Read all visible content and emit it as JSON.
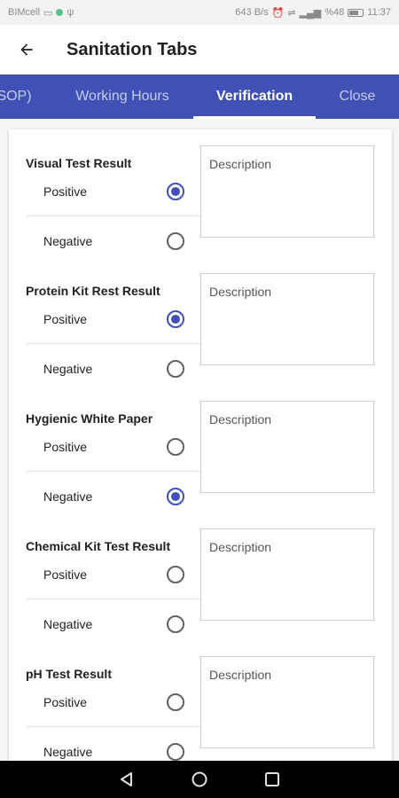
{
  "status_bar": {
    "carrier": "BIMcell",
    "speed": "643 B/s",
    "battery": "%48",
    "time": "11:37"
  },
  "app_bar": {
    "title": "Sanitation Tabs",
    "back_icon": "arrow-back-icon"
  },
  "tabs": [
    {
      "label": "SOP)",
      "active": false
    },
    {
      "label": "Working Hours",
      "active": false
    },
    {
      "label": "Verification",
      "active": true
    },
    {
      "label": "Close",
      "active": false
    }
  ],
  "colors": {
    "primary": "#3f51b5",
    "accent": "#3f51b5"
  },
  "sections": [
    {
      "title": "Visual Test Result",
      "options": [
        "Positive",
        "Negative"
      ],
      "selected": 0,
      "description_placeholder": "Description"
    },
    {
      "title": "Protein Kit Rest Result",
      "options": [
        "Positive",
        "Negative"
      ],
      "selected": 0,
      "description_placeholder": "Description"
    },
    {
      "title": "Hygienic White Paper",
      "options": [
        "Positive",
        "Negative"
      ],
      "selected": 1,
      "description_placeholder": "Description"
    },
    {
      "title": "Chemical Kit Test Result",
      "options": [
        "Positive",
        "Negative"
      ],
      "selected": null,
      "description_placeholder": "Description"
    },
    {
      "title": "pH Test Result",
      "options": [
        "Positive",
        "Negative"
      ],
      "selected": null,
      "description_placeholder": "Description"
    }
  ],
  "nav_bar": {
    "back": "triangle-back-icon",
    "home": "circle-home-icon",
    "recents": "square-recents-icon"
  }
}
